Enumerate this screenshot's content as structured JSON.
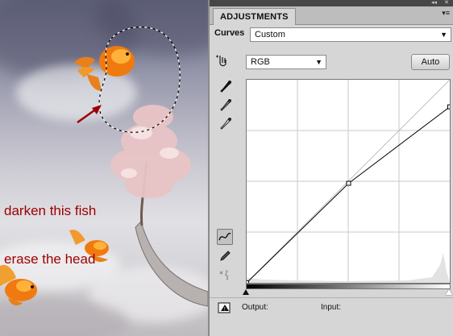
{
  "annotation": {
    "lines": [
      "darken this fish",
      "erase the head"
    ],
    "color": "#9b0000"
  },
  "panel": {
    "tab_label": "ADJUSTMENTS",
    "curves_label": "Curves",
    "preset_value": "Custom",
    "channel_value": "RGB",
    "auto_label": "Auto",
    "output_label": "Output:",
    "input_label": "Input:"
  },
  "curve": {
    "input_min": 0,
    "input_max": 255,
    "points": [
      [
        0,
        0
      ],
      [
        128,
        125
      ],
      [
        255,
        221
      ]
    ]
  },
  "icons": {
    "eyedropper_black": "eyedropper-black-icon",
    "eyedropper_gray": "eyedropper-gray-icon",
    "eyedropper_white": "eyedropper-white-icon",
    "targeted_adjust": "hand-target-icon",
    "curve_point_mode": "curve-tool-icon",
    "pencil_mode": "pencil-icon",
    "smooth": "smooth-icon",
    "clip_warning": "clip-warning-icon"
  }
}
